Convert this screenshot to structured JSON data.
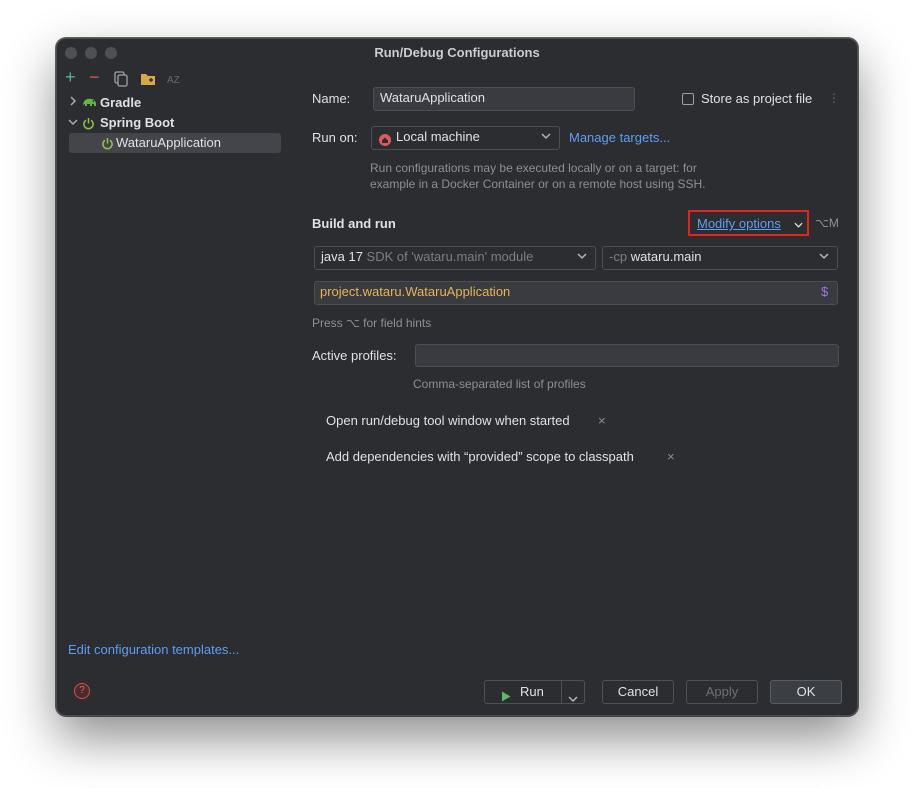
{
  "window": {
    "title": "Run/Debug Configurations"
  },
  "colors": {
    "background": "#2b2d30",
    "accent": "#5e9ef2",
    "highlight_border": "#e2241b",
    "class_text": "#e6b450",
    "ok_button": "#3b3e43"
  },
  "toolbar": {
    "icons": [
      "plus-icon",
      "minus-icon",
      "copy-icon",
      "folder-icon",
      "sort-az-icon"
    ],
    "sort_label": "AZ"
  },
  "tree": {
    "items": [
      {
        "label": "Gradle",
        "icon": "gradle-elephant-icon"
      },
      {
        "label": "Spring Boot",
        "icon": "power-icon"
      },
      {
        "label": "WataruApplication",
        "icon": "power-icon"
      }
    ]
  },
  "edit_templates_link": "Edit configuration templates...",
  "form": {
    "name_label": "Name:",
    "name_value": "WataruApplication",
    "store_label": "Store as project file",
    "run_on_label": "Run on:",
    "run_on_value": "Local machine",
    "manage_targets": "Manage targets...",
    "run_on_hint_line1": "Run configurations may be executed locally or on a target: for",
    "run_on_hint_line2": "example in a Docker Container or on a remote host using SSH.",
    "build_and_run": "Build and run",
    "modify_options": "Modify options",
    "modify_shortcut": "⌥M",
    "sdk_main": "java 17",
    "sdk_sub": "SDK of 'wataru.main' module",
    "cp_prefix": "-cp",
    "cp_value": "wataru.main",
    "main_class": "project.wataru.WataruApplication",
    "field_hints": "Press ⌥ for field hints",
    "active_profiles_label": "Active profiles:",
    "active_profiles_value": "",
    "profiles_hint": "Comma-separated list of profiles",
    "options": [
      {
        "label": "Open run/debug tool window when started"
      },
      {
        "label": "Add dependencies with “provided” scope to classpath"
      }
    ]
  },
  "footer": {
    "run_label": "Run",
    "cancel_label": "Cancel",
    "apply_label": "Apply",
    "ok_label": "OK",
    "help_glyph": "?"
  }
}
